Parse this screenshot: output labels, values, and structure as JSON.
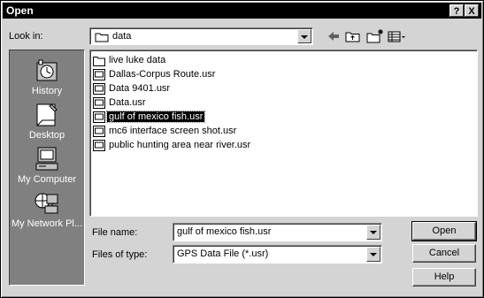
{
  "window": {
    "title": "Open",
    "help_button": "?",
    "close_button": "X"
  },
  "look_in": {
    "label": "Look in:",
    "value": "data"
  },
  "places": [
    {
      "label": "History",
      "icon": "history-icon"
    },
    {
      "label": "Desktop",
      "icon": "desktop-icon"
    },
    {
      "label": "My Computer",
      "icon": "my-computer-icon"
    },
    {
      "label": "My Network Pl...",
      "icon": "network-places-icon"
    }
  ],
  "files": [
    {
      "name": "live luke data",
      "type": "folder"
    },
    {
      "name": "Dallas-Corpus Route.usr",
      "type": "file"
    },
    {
      "name": "Data 9401.usr",
      "type": "file"
    },
    {
      "name": "Data.usr",
      "type": "file"
    },
    {
      "name": "gulf of mexico fish.usr",
      "type": "file",
      "selected": true
    },
    {
      "name": "mc6 interface screen shot.usr",
      "type": "file"
    },
    {
      "name": "public hunting area near river.usr",
      "type": "file"
    }
  ],
  "file_name": {
    "label": "File name:",
    "value": "gulf of mexico fish.usr"
  },
  "file_type": {
    "label": "Files of type:",
    "value": "GPS Data File (*.usr)"
  },
  "buttons": {
    "open": "Open",
    "cancel": "Cancel",
    "help": "Help"
  }
}
